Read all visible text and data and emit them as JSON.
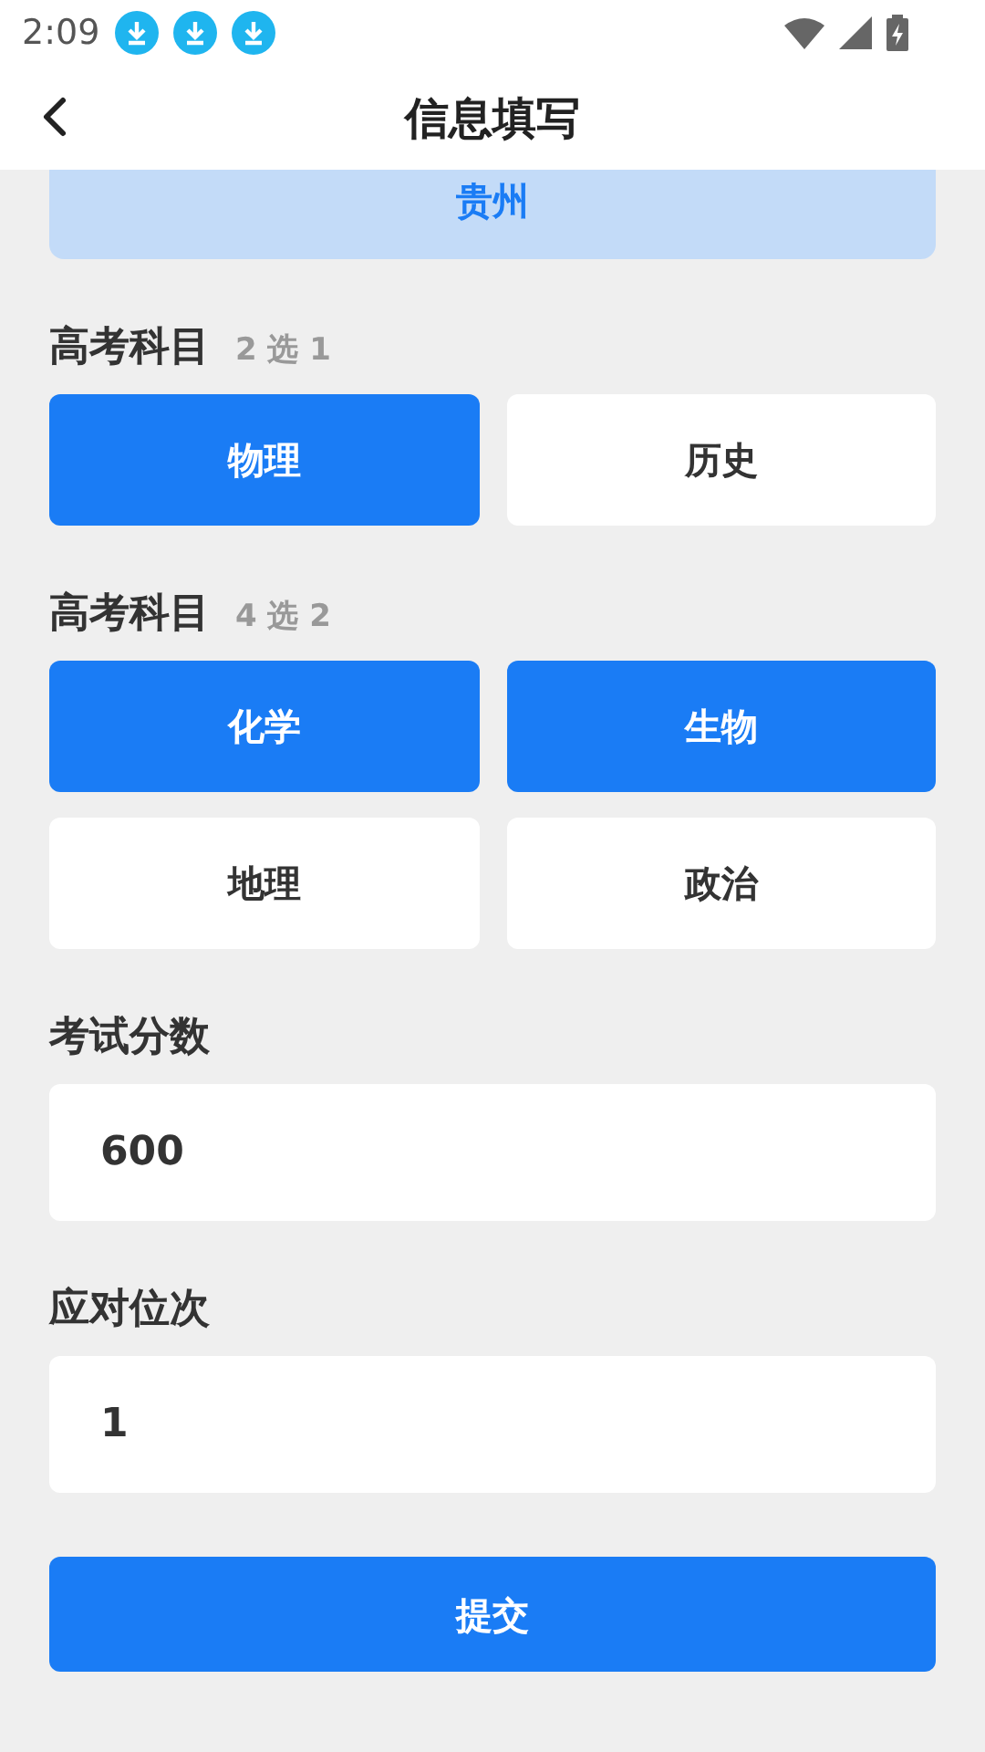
{
  "status_bar": {
    "time": "2:09",
    "notifications": [
      {
        "kind": "download"
      },
      {
        "kind": "download"
      },
      {
        "kind": "download"
      }
    ]
  },
  "header": {
    "title": "信息填写"
  },
  "province": {
    "value": "贵州",
    "selected": true
  },
  "groups": [
    {
      "title": "高考科目",
      "hint": "2 选 1",
      "options": [
        {
          "label": "物理",
          "selected": true
        },
        {
          "label": "历史",
          "selected": false
        }
      ]
    },
    {
      "title": "高考科目",
      "hint": "4 选 2",
      "options": [
        {
          "label": "化学",
          "selected": true
        },
        {
          "label": "生物",
          "selected": true
        },
        {
          "label": "地理",
          "selected": false
        },
        {
          "label": "政治",
          "selected": false
        }
      ]
    }
  ],
  "fields": [
    {
      "label": "考试分数",
      "value": "600"
    },
    {
      "label": "应对位次",
      "value": "1"
    }
  ],
  "submit": {
    "label": "提交"
  }
}
